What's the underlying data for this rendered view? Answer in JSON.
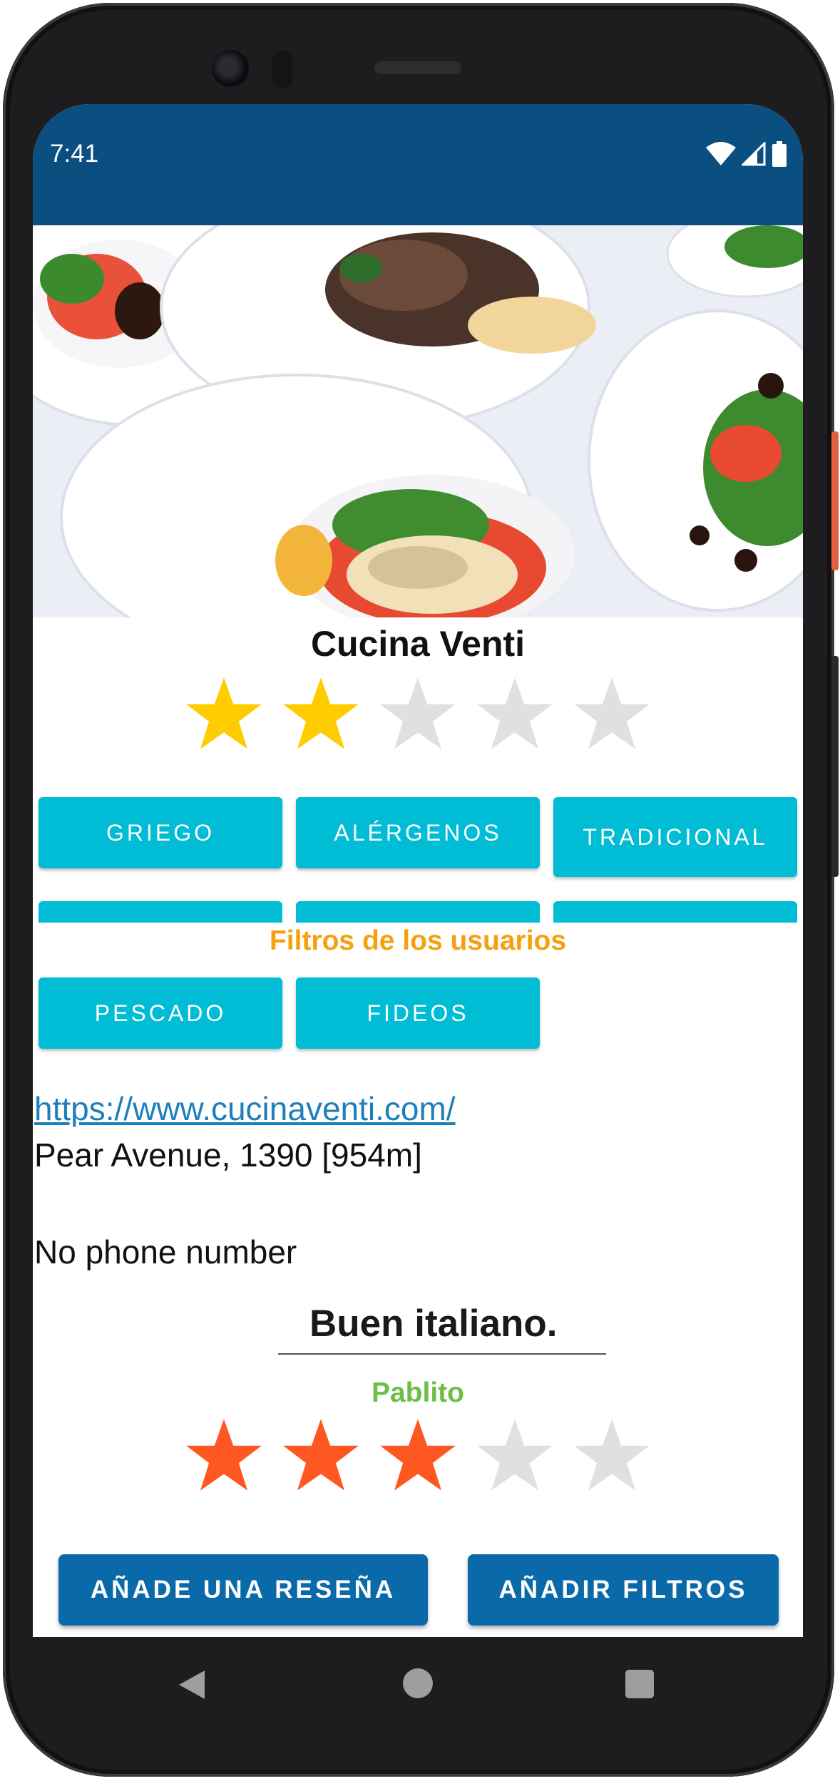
{
  "status_bar": {
    "time": "7:41",
    "icons": [
      "wifi-icon",
      "cellular-signal-icon",
      "battery-icon"
    ],
    "background_color": "#0b4f80"
  },
  "restaurant": {
    "name": "Cucina Venti",
    "rating": 2,
    "rating_max": 5,
    "star_on_color": "#ffcc00",
    "star_off_color": "#e0e0e0"
  },
  "tags": [
    {
      "label": "GRIEGO"
    },
    {
      "label": "ALÉRGENOS"
    },
    {
      "label": "TRADICIONAL"
    }
  ],
  "user_filters": {
    "header": "Filtros de los usuarios",
    "items": [
      {
        "label": "PESCADO"
      },
      {
        "label": "FIDEOS"
      }
    ]
  },
  "contact": {
    "website": "https://www.cucinaventi.com/",
    "address": "Pear Avenue, 1390 [954m]",
    "phone": "No phone number"
  },
  "review": {
    "title": "Buen italiano.",
    "author": "Pablito",
    "rating": 3,
    "rating_max": 5,
    "star_on_color": "#ff5722"
  },
  "actions": {
    "add_review": "AÑADE UNA RESEÑA",
    "add_filters": "AÑADIR FILTROS"
  },
  "navbar": {
    "icons": [
      "back-icon",
      "home-icon",
      "recents-icon"
    ]
  },
  "colors": {
    "chip": "#00bcd4",
    "primary_button": "#0a6aa9",
    "filters_header": "#f5a00f",
    "author": "#6cbf44",
    "link": "#1e7fba"
  }
}
